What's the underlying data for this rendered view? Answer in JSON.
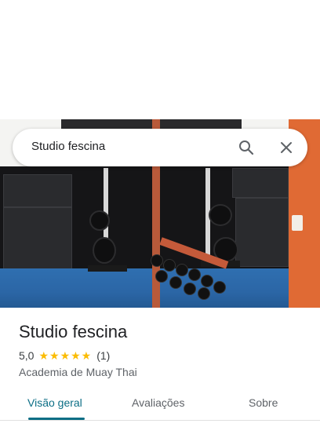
{
  "search": {
    "query": "Studio fescina",
    "search_icon": "search-icon",
    "close_icon": "close-icon"
  },
  "photo": {
    "description_icon": "place-photo"
  },
  "place": {
    "name": "Studio fescina",
    "rating": "5,0",
    "stars": "★★★★★",
    "rating_fraction": 1.0,
    "review_count": "(1)",
    "category": "Academia de Muay Thai"
  },
  "tabs": [
    {
      "label": "Visão geral",
      "active": true
    },
    {
      "label": "Avaliações",
      "active": false
    },
    {
      "label": "Sobre",
      "active": false
    }
  ],
  "colors": {
    "accent": "#0b6e85",
    "star": "#fbbc04"
  }
}
